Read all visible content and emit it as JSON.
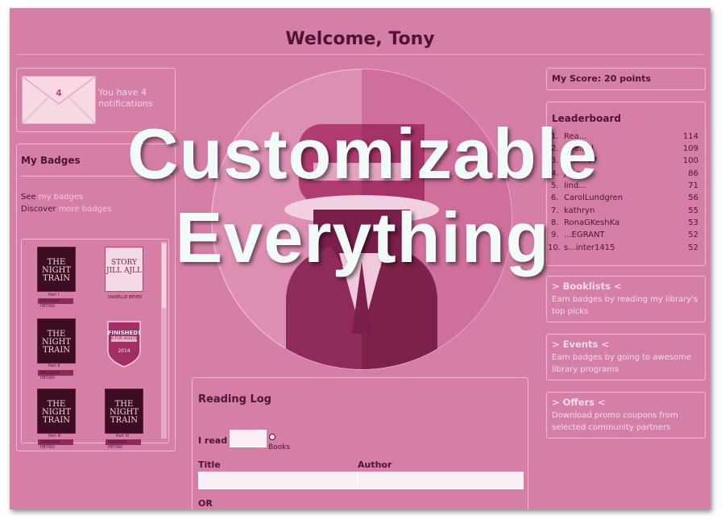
{
  "header": {
    "title": "Welcome, Tony"
  },
  "notifications": {
    "count": "4",
    "text": "You have 4 notifications"
  },
  "badges": {
    "title": "My Badges",
    "see_prefix": "See",
    "see_link": "my badges",
    "discover_prefix": "Discover",
    "discover_link": "more badges",
    "items": [
      {
        "title": "THE NIGHT TRAIN",
        "author": "BARBARA HEYSKI",
        "part": "Part I"
      },
      {
        "title": "STORY JILL AJLL",
        "author": "DANIELLE BEVER",
        "part": ""
      },
      {
        "title": "THE NIGHT TRAIN",
        "author": "BARBARA HEYSKI",
        "part": "Part II"
      },
      {
        "title": "FINISHED!",
        "author": "YA FOR ADULTS!",
        "part": "2014"
      },
      {
        "title": "THE NIGHT TRAIN",
        "author": "BARBARA HEYSKI",
        "part": "Part III"
      },
      {
        "title": "THE NIGHT TRAIN",
        "author": "BARBARA HEYSKI",
        "part": "Part IV"
      }
    ]
  },
  "score": {
    "text": "My Score: 20 points"
  },
  "leaderboard": {
    "title": "Leaderboard",
    "rows": [
      {
        "rank": "1.",
        "name": "Rea...",
        "points": "114"
      },
      {
        "rank": "2.",
        "name": "goe...el",
        "points": "109"
      },
      {
        "rank": "3.",
        "name": "test...07",
        "points": "100"
      },
      {
        "rank": "4.",
        "name": "Jenn...",
        "points": "86"
      },
      {
        "rank": "5.",
        "name": "lind...",
        "points": "71"
      },
      {
        "rank": "6.",
        "name": "CarolLundgren",
        "points": "56"
      },
      {
        "rank": "7.",
        "name": "kathryn",
        "points": "55"
      },
      {
        "rank": "8.",
        "name": "RonaGKeshKa",
        "points": "53"
      },
      {
        "rank": "9.",
        "name": "...EGRANT",
        "points": "52"
      },
      {
        "rank": "10.",
        "name": "s...inter1415",
        "points": "52"
      }
    ]
  },
  "side": {
    "booklists": {
      "title": "> Booklists <",
      "body": "Earn badges by reading my library's top picks"
    },
    "events": {
      "title": "> Events <",
      "body": "Earn badges by going to awesome library programs"
    },
    "offers": {
      "title": "> Offers <",
      "body": "Download promo coupons from selected community partners"
    }
  },
  "reading_log": {
    "title": "Reading Log",
    "i_read": "I read",
    "unit": "Books",
    "title_label": "Title",
    "author_label": "Author",
    "or_label": "OR"
  },
  "overlay": {
    "line1": "Customizable",
    "line2": "Everything"
  },
  "colors": {
    "background": "#d57fa6",
    "accent": "#4e1432",
    "overlay_text": "#f2fbf8"
  }
}
